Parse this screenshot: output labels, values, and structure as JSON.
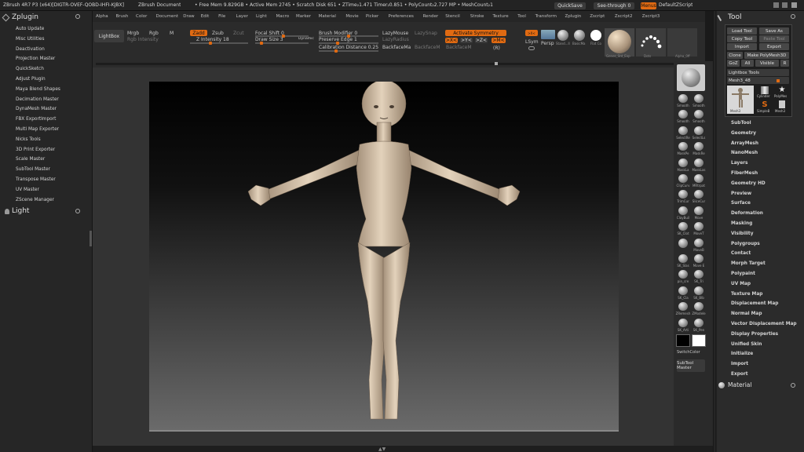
{
  "titlebar": {
    "app": "ZBrush 4R7 P3 (x64)[DIGTR-OVEF-QOBD-IHFI-KJBX]",
    "doc": "ZBrush Document",
    "stats": "• Free Mem 9.829GB • Active Mem 2745 • Scratch Disk 651 • ZTime₂1.471 Timer₂0.851 • PolyCount₂2.727 MP • MeshCount₂1",
    "quicksave": "QuickSave",
    "seethrough": "See-through  0",
    "menus_btn": "Menus",
    "defaultscript": "DefaultZScript"
  },
  "menubar": [
    "Alpha",
    "Brush",
    "Color",
    "Document",
    "Draw",
    "Edit",
    "File",
    "Layer",
    "Light",
    "Macro",
    "Marker",
    "Material",
    "Movie",
    "Picker",
    "Preferences",
    "Render",
    "Stencil",
    "Stroke",
    "Texture",
    "Tool",
    "Transform",
    "Zplugin",
    "Zscript",
    "Zscript2",
    "Zscript3"
  ],
  "leftpanel": {
    "header": "Zplugin",
    "items": [
      "Auto Update",
      "Misc Utilities",
      "Deactivation",
      "Projection Master",
      "QuickSketch",
      "Adjust Plugin",
      "Maya Blend Shapes",
      "Decimation Master",
      "DynaMesh Master",
      "FBX ExportImport",
      "Multi Map Exporter",
      "Nicks Tools",
      "3D Print Exporter",
      "Scale Master",
      "SubTool Master",
      "Transpose Master",
      "UV Master",
      "ZScene Manager"
    ],
    "light_header": "Light"
  },
  "toolbar": {
    "lightbox": "LightBox",
    "mrgb": "Mrgb",
    "rgb": "Rgb",
    "m": "M",
    "zadd": "Zadd",
    "zsub": "Zsub",
    "zcut": "Zcut",
    "rgb_intensity": "Rgb  Intensity",
    "z_intensity": "Z Intensity 18",
    "focal_shift": "Focal Shift 0",
    "draw_size": "Draw Size 3",
    "dynamic": "Dynamic",
    "brush_modifier": "Brush Modifier 0",
    "preserve_edge": "Preserve Edge 1",
    "calibration": "Calibration Distance 0.25",
    "lazymouse": "LazyMouse",
    "lazysnap": "LazySnap",
    "lazyradius": "LazyRadius",
    "backfacemask": "BackfaceMa",
    "backfacemask2": "BackfaceM",
    "backfacemask3": "BackfaceM",
    "activate_symmetry": "Activate Symmetry",
    "sym_x": ">X<",
    "sym_y": ">Y<",
    "sym_z": ">Z<",
    "sym_m": ">M<",
    "sym_r": "(R)",
    "lsym": "LSym",
    "lsym_top": ">X<",
    "persp": "Persp",
    "brush_thumb_labels": [
      "Stand...ll",
      "BasicMa",
      "Flat Co"
    ],
    "large_thumbs": [
      "Genes_Std_Exp",
      "Dots",
      "Alpha_0ff"
    ]
  },
  "shelf": {
    "buttons": [
      [
        "Smooth",
        "Smooth"
      ],
      [
        "Smooth",
        "Smooth"
      ],
      [
        "SelectRe",
        "SelectLs"
      ],
      [
        "MaskPe",
        "MaskRe"
      ],
      [
        "MaskLa",
        "MaskLas"
      ],
      [
        "ClipCurv",
        "MRtrpat"
      ],
      [
        "TrimCur",
        "SliceCur"
      ],
      [
        "ClayBuil",
        "Move"
      ],
      [
        "SK_Clot",
        "MoveT"
      ],
      [
        "",
        "MoveB"
      ],
      [
        "SK_Slas",
        "Move E"
      ],
      [
        "pin_cre",
        "SK_Tri"
      ],
      [
        "SK_Cla",
        "SK_Blb"
      ],
      [
        "ZRemesh",
        "ZModele"
      ],
      [
        "SK_Arti",
        "SK_Pen"
      ]
    ],
    "switchcolor": "SwitchColor",
    "subtool_master": "SubTool Master",
    "colors": {
      "main": "#000000",
      "secondary": "#ffffff"
    }
  },
  "toolpanel": {
    "header": "Tool",
    "buttons": [
      "Load Tool",
      "Save As",
      "Copy Tool",
      "Paste Tool",
      "Import",
      "Export",
      "Clone",
      "Make PolyMesh3D",
      "GoZ",
      "All",
      "Visible",
      "R"
    ],
    "lightbox_tools": "Lightbox  Tools",
    "mesh_slider": "Mesh3_48",
    "thumbs": [
      "Mesh3",
      "Cylinder",
      "PolyMes",
      "SimpleB",
      "Mesh3"
    ],
    "items": [
      "SubTool",
      "Geometry",
      "ArrayMesh",
      "NanoMesh",
      "Layers",
      "FiberMesh",
      "Geometry HD",
      "Preview",
      "Surface",
      "Deformation",
      "Masking",
      "Visibility",
      "Polygroups",
      "Contact",
      "Morph Target",
      "Polypaint",
      "UV Map",
      "Texture Map",
      "Displacement Map",
      "Normal Map",
      "Vector Displacement Map",
      "Display Properties",
      "Unified Skin",
      "Initialize",
      "Import",
      "Export"
    ],
    "material_header": "Material"
  },
  "colors": {
    "accent": "#e06a12",
    "panel": "#2b2b2b",
    "skin": "#d6c3aa"
  }
}
